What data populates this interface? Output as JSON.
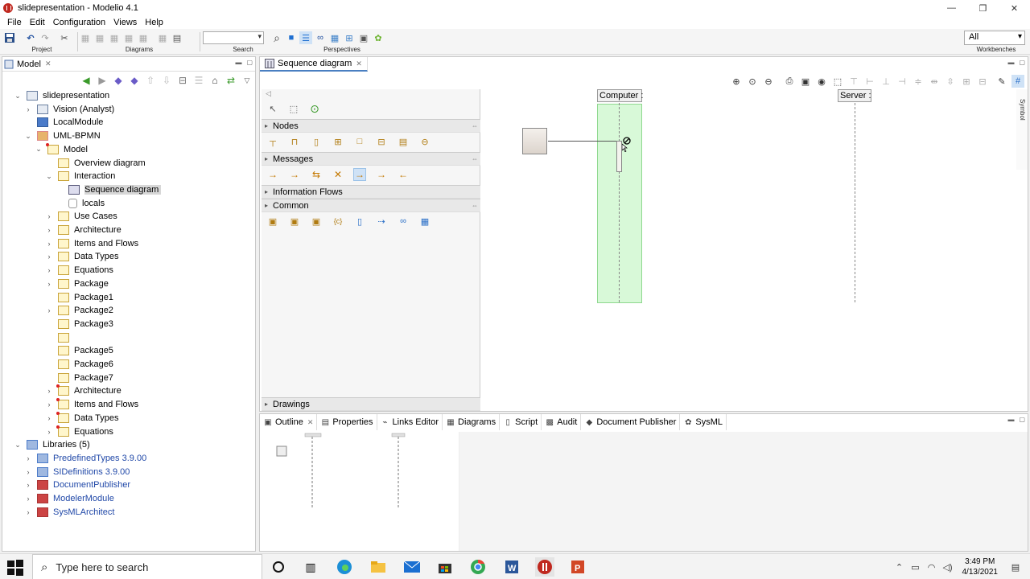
{
  "window": {
    "title": "slidepresentation - Modelio 4.1",
    "controls": [
      "—",
      "❐",
      "✕"
    ]
  },
  "menu": [
    "File",
    "Edit",
    "Configuration",
    "Views",
    "Help"
  ],
  "toolbar": {
    "groups": {
      "project": "Project",
      "diagrams": "Diagrams",
      "search": "Search",
      "perspectives": "Perspectives",
      "workbenches": "Workbenches"
    },
    "workbench_value": "All"
  },
  "model_panel": {
    "tab_label": "Model",
    "tree": [
      {
        "label": "slidepresentation",
        "level": 0,
        "expanded": true,
        "icon": "project-icon"
      },
      {
        "label": "Vision (Analyst)",
        "level": 1,
        "expanded": false,
        "icon": "project-icon"
      },
      {
        "label": "LocalModule",
        "level": 1,
        "expanded": null,
        "icon": "module-icon"
      },
      {
        "label": "UML-BPMN",
        "level": 1,
        "expanded": true,
        "icon": "uml-icon"
      },
      {
        "label": "Model",
        "level": 2,
        "expanded": true,
        "icon": "package-red-icon"
      },
      {
        "label": "Overview diagram",
        "level": 3,
        "expanded": null,
        "icon": "diagram-icon"
      },
      {
        "label": "Interaction",
        "level": 3,
        "expanded": true,
        "icon": "interaction-icon"
      },
      {
        "label": "Sequence diagram",
        "level": 4,
        "expanded": null,
        "icon": "sequence-icon",
        "selected": true
      },
      {
        "label": "locals",
        "level": 4,
        "expanded": null,
        "icon": "locals-icon"
      },
      {
        "label": "Use Cases",
        "level": 3,
        "expanded": false,
        "icon": "package-icon"
      },
      {
        "label": "Architecture",
        "level": 3,
        "expanded": false,
        "icon": "package-icon"
      },
      {
        "label": "Items and Flows",
        "level": 3,
        "expanded": false,
        "icon": "package-icon"
      },
      {
        "label": "Data Types",
        "level": 3,
        "expanded": false,
        "icon": "package-icon"
      },
      {
        "label": "Equations",
        "level": 3,
        "expanded": false,
        "icon": "package-icon"
      },
      {
        "label": "Package",
        "level": 3,
        "expanded": false,
        "icon": "package-icon"
      },
      {
        "label": "Package1",
        "level": 3,
        "expanded": null,
        "icon": "package-icon"
      },
      {
        "label": "Package2",
        "level": 3,
        "expanded": false,
        "icon": "package-icon"
      },
      {
        "label": "Package3",
        "level": 3,
        "expanded": null,
        "icon": "package-icon"
      },
      {
        "label": "",
        "level": 3,
        "expanded": null,
        "icon": "package-icon"
      },
      {
        "label": "Package5",
        "level": 3,
        "expanded": null,
        "icon": "package-icon"
      },
      {
        "label": "Package6",
        "level": 3,
        "expanded": null,
        "icon": "package-icon"
      },
      {
        "label": "Package7",
        "level": 3,
        "expanded": null,
        "icon": "package-icon"
      },
      {
        "label": "Architecture",
        "level": 3,
        "expanded": false,
        "icon": "package-red-icon"
      },
      {
        "label": "Items and Flows",
        "level": 3,
        "expanded": false,
        "icon": "package-red-icon"
      },
      {
        "label": "Data Types",
        "level": 3,
        "expanded": false,
        "icon": "package-red-icon"
      },
      {
        "label": "Equations",
        "level": 3,
        "expanded": false,
        "icon": "package-red-icon"
      },
      {
        "label": "Libraries (5)",
        "level": 0,
        "expanded": true,
        "icon": "library-icon"
      },
      {
        "label": "PredefinedTypes 3.9.00",
        "level": 1,
        "expanded": false,
        "icon": "library-icon",
        "link": true
      },
      {
        "label": "SIDefinitions 3.9.00",
        "level": 1,
        "expanded": false,
        "icon": "library-icon",
        "link": true
      },
      {
        "label": "DocumentPublisher",
        "level": 1,
        "expanded": false,
        "icon": "addin-icon",
        "link": true
      },
      {
        "label": "ModelerModule",
        "level": 1,
        "expanded": false,
        "icon": "addin-icon",
        "link": true
      },
      {
        "label": "SysMLArchitect",
        "level": 1,
        "expanded": false,
        "icon": "addin-icon",
        "link": true
      }
    ]
  },
  "editor": {
    "tab_label": "Sequence diagram",
    "palette": {
      "sections": [
        "Nodes",
        "Messages",
        "Information Flows",
        "Common",
        "Drawings"
      ],
      "node_icons": [
        "lifeline-icon",
        "interaction-use-icon",
        "execution-icon",
        "combined-fragment-icon",
        "state-invariant-icon",
        "gate-icon",
        "partition-icon",
        "continuation-icon"
      ],
      "message_icons": [
        "→",
        "→",
        "⇆",
        "✕",
        "→",
        "→",
        "←"
      ],
      "common_icons": [
        "package-tool-icon",
        "requirement-tool-icon",
        "note-tool-icon",
        "constraint-tool-icon",
        "document-tool-icon",
        "dependency-tool-icon",
        "link-tool-icon",
        "diagram-tool-icon"
      ]
    },
    "canvas": {
      "lifelines": [
        "Computer :",
        "Server :"
      ],
      "side_label": "Symbol"
    }
  },
  "bottom_tabs": [
    "Outline",
    "Properties",
    "Links Editor",
    "Diagrams",
    "Script",
    "Audit",
    "Document Publisher",
    "SysML"
  ],
  "taskbar": {
    "search_placeholder": "Type here to search",
    "time": "3:49 PM",
    "date": "4/13/2021"
  },
  "colors": {
    "highlight": "#90ee90",
    "link_text": "#2048a8",
    "accent": "#4a7fc1"
  }
}
